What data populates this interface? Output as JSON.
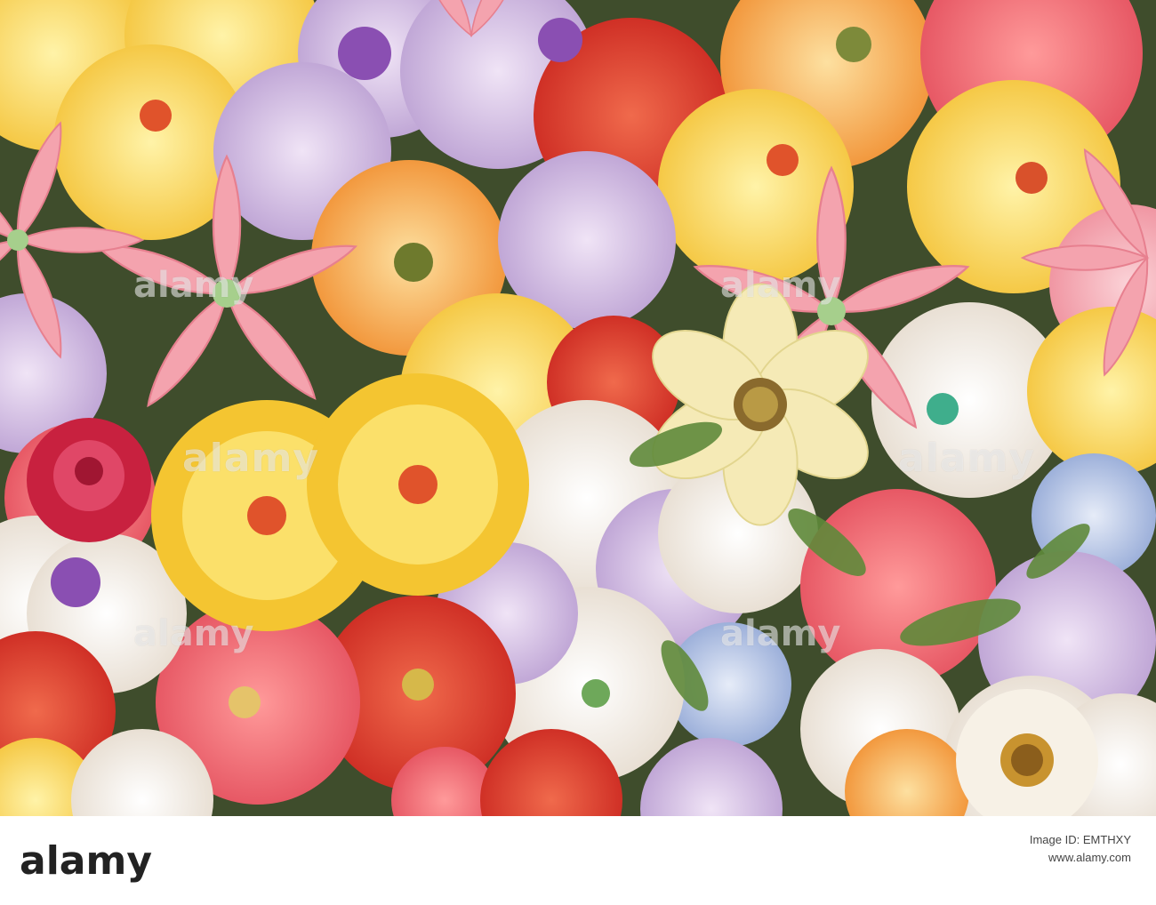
{
  "watermark": {
    "text": "alamy"
  },
  "footer": {
    "logo": "alamy",
    "image_id_label": "Image ID: EMTHXY",
    "site": "www.alamy.com"
  },
  "colors": {
    "pink_lily": "#f4a3ae",
    "red": "#e0352b",
    "yellow": "#f6d13a",
    "purple": "#8a4fb2",
    "white": "#f4ecdf",
    "foliage": "#3f4d2c",
    "lavender": "#c9b3d8"
  }
}
